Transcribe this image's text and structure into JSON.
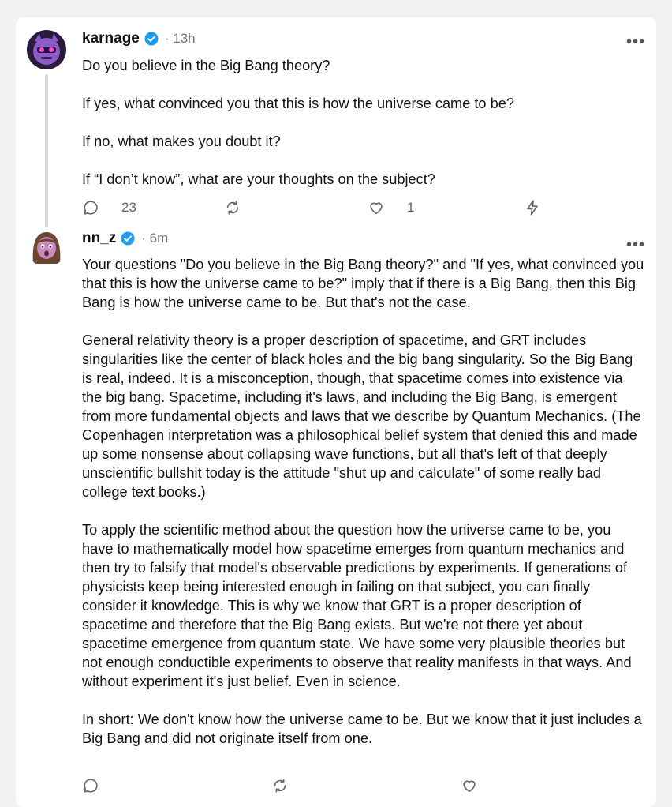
{
  "posts": [
    {
      "username": "karnage",
      "time": "13h",
      "avatar_icon": "purple-robot-avatar",
      "paragraphs": [
        "Do you believe in the Big Bang theory?",
        "If yes, what convinced you that this is how the universe came to be?",
        "If no, what makes you doubt it?",
        "If “I don’t know”, what are your thoughts on the subject?"
      ],
      "reply_count": "23",
      "like_count": "1"
    },
    {
      "username": "nn_z",
      "time": "6m",
      "avatar_icon": "surprised-woman-emoji-avatar",
      "paragraphs": [
        "Your questions \"Do you believe in the Big Bang theory?\" and \"If yes, what convinced you that this is how the universe came to be?\" imply that if there is a Big Bang, then this Big Bang is how the universe came to be. But that's not the case.",
        "General relativity theory is a proper description of spacetime, and GRT includes singularities like the center of black holes and the big bang singularity. So the Big Bang is real, indeed. It is a misconception, though, that spacetime comes into existence via the big bang. Spacetime, including it's laws, and including the Big Bang, is emergent from more fundamental objects and laws that we describe by Quantum Mechanics. (The Copenhagen interpretation was a philosophical belief system that denied this and made up some nonsense about collapsing wave functions, but all that's left of that deeply unscientific bullshit today is the attitude \"shut up and calculate\" of some really bad college text books.)",
        "To apply the scientific method about the question how the universe came to be, you have to mathematically model how spacetime emerges from quantum mechanics and then try to falsify that model's observable predictions by experiments. If generations of physicists keep being interested enough in failing on that subject, you can finally consider it knowledge. This is why we know that GRT is a proper description of spacetime and therefore that the Big Bang exists. But we're not there yet about spacetime emergence from quantum state. We have some very plausible theories but not enough conductible experiments to observe that reality manifests in that ways. And without experiment it's just belief. Even in science.",
        "In short: We don't know how the universe came to be. But we know that it just includes a Big Bang and did not originate itself from one."
      ]
    }
  ],
  "colors": {
    "verified": "#1d9bf0",
    "thread_line": "#d8d8d8",
    "icon": "#666666"
  }
}
